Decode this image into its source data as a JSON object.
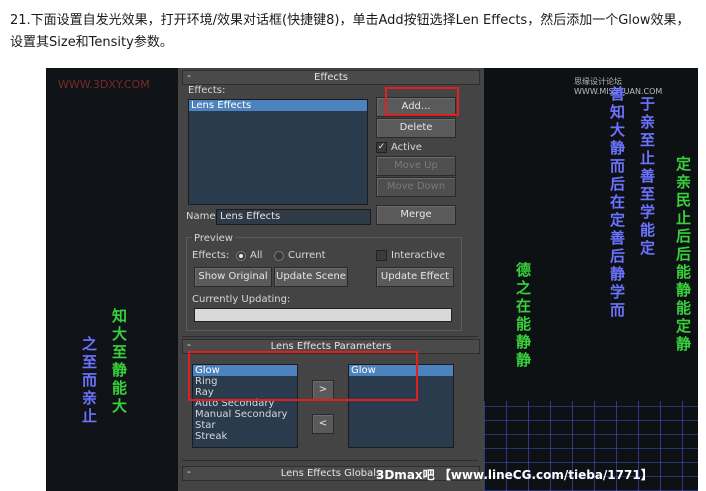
{
  "instruction": "21.下面设置自发光效果，打开环境/效果对话框(快捷键8)，单击Add按钮选择Len Effects，然后添加一个Glow效果，设置其Size和Tensity参数。",
  "watermark_left": "WWW.3DXY.COM",
  "watermark_right": "思缘设计论坛 WWW.MISSYUAN.COM",
  "footer": "3Dmax吧 【www.lineCG.com/tieba/1771】",
  "viewport_left_text": {
    "col1": "之至而亲止",
    "col2": "知大至静能大",
    "col3": ""
  },
  "viewport_right_text": {
    "col1": "德之在能静静",
    "col2": "善知大静而后在定善后静学而",
    "col3": "于亲至止善至学能定",
    "col4": "定亲民止后后能静能定静"
  },
  "effects_panel": {
    "rollout_title": "Effects",
    "effects_label": "Effects:",
    "effects_list": [
      "Lens Effects"
    ],
    "selected_effect": "Lens Effects",
    "buttons": {
      "add": "Add...",
      "delete": "Delete",
      "move_up": "Move Up",
      "move_down": "Move Down",
      "merge": "Merge"
    },
    "active_label": "Active",
    "active_checked": true,
    "name_label": "Name:",
    "name_value": "Lens Effects",
    "preview": {
      "group_label": "Preview",
      "effects_label": "Effects:",
      "all_label": "All",
      "current_label": "Current",
      "selected_radio": "All",
      "interactive_label": "Interactive",
      "interactive_checked": false,
      "show_original": "Show Original",
      "update_scene": "Update Scene",
      "update_effect": "Update Effect",
      "currently_updating_label": "Currently Updating:",
      "progress": 0
    }
  },
  "lens_params_panel": {
    "rollout_title": "Lens Effects Parameters",
    "available": [
      "Glow",
      "Ring",
      "Ray",
      "Auto Secondary",
      "Manual Secondary",
      "Star",
      "Streak"
    ],
    "selected_available": "Glow",
    "add_arrow": ">",
    "remove_arrow": "<",
    "applied": [
      "Glow"
    ],
    "selected_applied": "Glow"
  },
  "globals_panel": {
    "rollout_title": "Lens Effects Globals"
  },
  "colors": {
    "highlight": "#e02020",
    "selection": "#4c83bf",
    "panel_bg": "#444444",
    "list_bg": "#2b3b4e"
  }
}
